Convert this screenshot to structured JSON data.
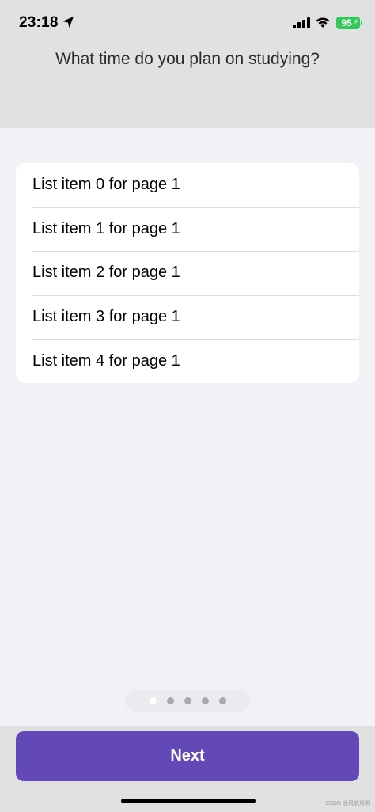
{
  "status_bar": {
    "time": "23:18",
    "battery_level": "95",
    "icons": [
      "location-arrow-icon",
      "cellular-signal-icon",
      "wifi-icon",
      "battery-icon"
    ]
  },
  "header": {
    "title": "What time do you plan on studying?"
  },
  "list": {
    "items": [
      {
        "label": "List item 0 for page 1"
      },
      {
        "label": "List item 1 for page 1"
      },
      {
        "label": "List item 2 for page 1"
      },
      {
        "label": "List item 3 for page 1"
      },
      {
        "label": "List item 4 for page 1"
      }
    ]
  },
  "pager": {
    "page_count": 5,
    "current_page": 1
  },
  "footer": {
    "next_label": "Next"
  },
  "watermark": "CSDN @风浪月明",
  "colors": {
    "accent": "#6349b8",
    "header_bg": "#e1e1e1",
    "screen_bg": "#f2f1f6",
    "battery": "#34c759"
  }
}
